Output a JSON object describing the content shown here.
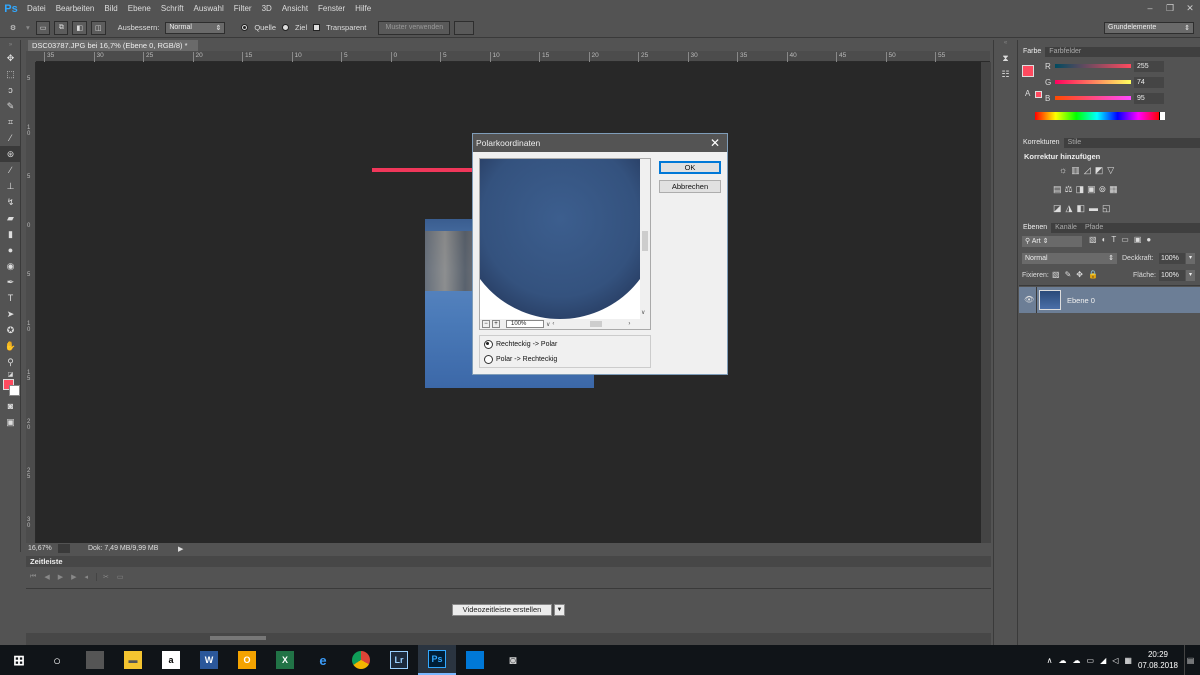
{
  "app": {
    "logo": "Ps"
  },
  "menu": [
    "Datei",
    "Bearbeiten",
    "Bild",
    "Ebene",
    "Schrift",
    "Auswahl",
    "Filter",
    "3D",
    "Ansicht",
    "Fenster",
    "Hilfe"
  ],
  "window_controls": [
    "–",
    "❐",
    "✕"
  ],
  "options": {
    "repair_label": "Ausbessern:",
    "repair_mode": "Normal",
    "source_label": "Quelle",
    "target_label": "Ziel",
    "transparent_label": "Transparent",
    "use_pattern_label": "Muster verwenden",
    "workspace": "Grundelemente"
  },
  "document": {
    "tab_title": "DSC03787.JPG bei 16,7% (Ebene 0, RGB/8) *",
    "tab_close": "×",
    "zoom": "16,67%",
    "doc_size": "Dok: 7,49 MB/9,99 MB",
    "hruler_labels": [
      "35",
      "30",
      "25",
      "20",
      "15",
      "10",
      "5",
      "0",
      "5",
      "10",
      "15",
      "20",
      "25",
      "30",
      "35",
      "40",
      "45",
      "50",
      "55"
    ],
    "vruler_labels": [
      "5",
      "1 0",
      "5",
      "0",
      "5",
      "1 0",
      "1 5",
      "2 0",
      "2 5",
      "3 0"
    ]
  },
  "timeline": {
    "title": "Zeitleiste",
    "create_label": "Videozeitleiste erstellen"
  },
  "dialog": {
    "title": "Polarkoordinaten",
    "ok_label": "OK",
    "cancel_label": "Abbrechen",
    "zoom_value": "100%",
    "option_rect_to_polar": "Rechteckig -> Polar",
    "option_polar_to_rect": "Polar -> Rechteckig",
    "selected_option": "Rechteckig -> Polar"
  },
  "color_panel": {
    "tabs": [
      "Farbe",
      "Farbfelder"
    ],
    "r_label": "R",
    "r_value": "255",
    "g_label": "G",
    "g_value": "74",
    "b_label": "B",
    "b_value": "95",
    "foreground_color": "#ff4a5f"
  },
  "adjustments_panel": {
    "tabs": [
      "Korrekturen",
      "Stile"
    ],
    "heading": "Korrektur hinzufügen"
  },
  "layers_panel": {
    "tabs": [
      "Ebenen",
      "Kanäle",
      "Pfade"
    ],
    "filter_kind": "Art",
    "blend_mode": "Normal",
    "opacity_label": "Deckkraft:",
    "opacity_value": "100%",
    "lock_label": "Fixieren:",
    "fill_label": "Fläche:",
    "fill_value": "100%",
    "layers": [
      {
        "name": "Ebene 0"
      }
    ]
  },
  "taskbar": {
    "time": "20:29",
    "date": "07.08.2018"
  },
  "colors": {
    "accent_arrow": "#f0375a",
    "ps_blue": "#31a8ff",
    "dialog_default_border": "#0078d7"
  }
}
